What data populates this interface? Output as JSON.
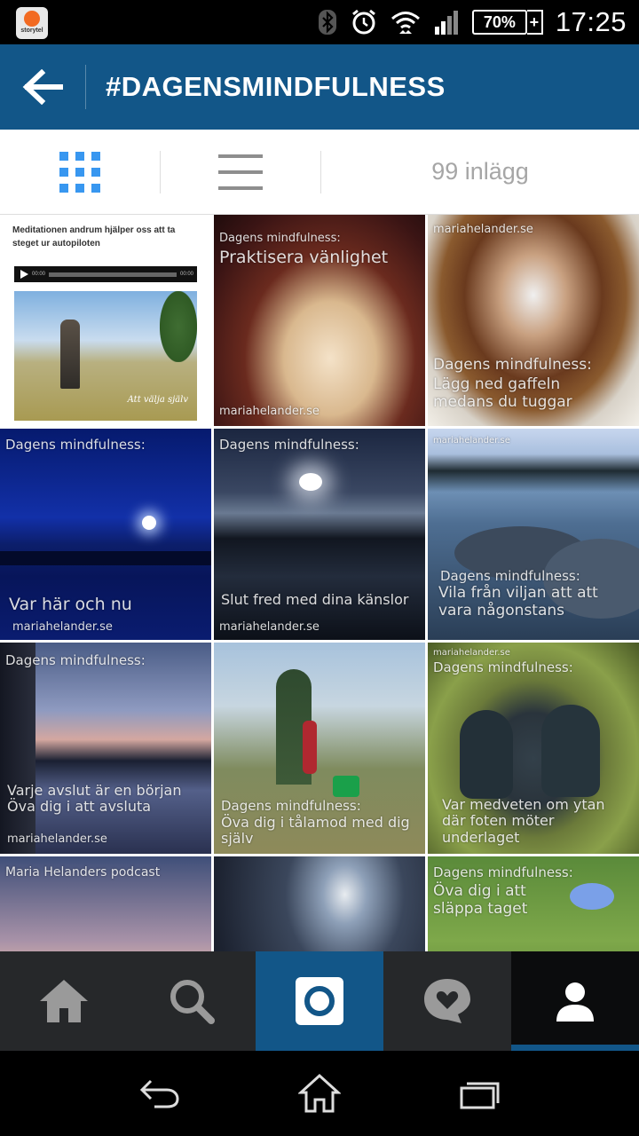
{
  "status_bar": {
    "app_notification_label": "storytel",
    "battery": "70%",
    "time": "17:25",
    "icons": [
      "bluetooth-icon",
      "alarm-icon",
      "wifi-icon",
      "signal-icon",
      "battery-icon"
    ]
  },
  "app_bar": {
    "title": "#DAGENSMINDFULNESS",
    "back_icon": "arrow-left-icon"
  },
  "switcher": {
    "post_count": "99 inlägg"
  },
  "posts": [
    {
      "text_a": "Meditationen andrum hjälper oss att ta steget ur autopiloten",
      "text_b": "00:00",
      "text_c": "00:00",
      "text_d": "Att välja själv"
    },
    {
      "text_a": "Dagens mindfulness:",
      "text_b": "Praktisera vänlighet",
      "text_c": "mariahelander.se"
    },
    {
      "text_a": "mariahelander.se",
      "text_b": "Dagens mindfulness:",
      "text_c": "Lägg ned gaffeln medans du tuggar"
    },
    {
      "text_a": "Dagens mindfulness:",
      "text_b": "Var här och nu",
      "text_c": "mariahelander.se"
    },
    {
      "text_a": "Dagens mindfulness:",
      "text_b": "Slut fred med dina känslor",
      "text_c": "mariahelander.se"
    },
    {
      "text_a": "mariahelander.se",
      "text_b": "Dagens mindfulness:",
      "text_c": "Vila från viljan att att vara någonstans"
    },
    {
      "text_a": "Dagens mindfulness:",
      "text_b": "Varje avslut är en början Öva dig i att avsluta",
      "text_c": "mariahelander.se"
    },
    {
      "text_a": "Dagens mindfulness:",
      "text_b": "Öva dig i tålamod med dig själv"
    },
    {
      "text_a": "mariahelander.se",
      "text_b": "Dagens mindfulness:",
      "text_c": "Var medveten om ytan där foten möter underlaget"
    },
    {
      "text_a": "Maria Helanders podcast"
    },
    {},
    {
      "text_a": "Dagens mindfulness:",
      "text_b": "Öva dig i att släppa taget"
    }
  ],
  "bottom_nav": [
    {
      "name": "home",
      "icon": "home-icon"
    },
    {
      "name": "search",
      "icon": "search-icon"
    },
    {
      "name": "camera",
      "icon": "camera-icon"
    },
    {
      "name": "activity",
      "icon": "heart-bubble-icon"
    },
    {
      "name": "profile",
      "icon": "person-icon"
    }
  ],
  "system_nav": [
    "back-icon",
    "home-outline-icon",
    "recent-apps-icon"
  ],
  "colors": {
    "brand_blue": "#125688",
    "grid_icon_blue": "#3897f0",
    "nav_bg": "#26282a"
  }
}
